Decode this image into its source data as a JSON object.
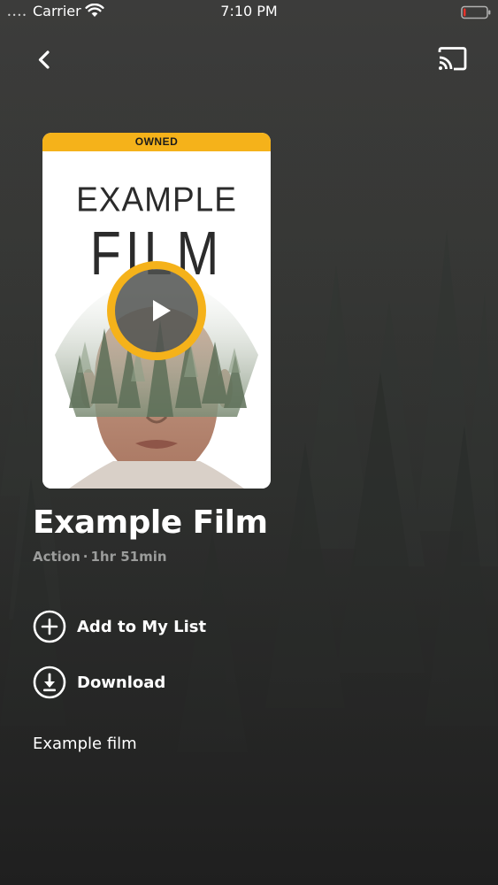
{
  "status_bar": {
    "signal_dots": "••••",
    "carrier": "Carrier",
    "time": "7:10 PM",
    "wifi_icon": "wifi-icon",
    "battery_icon": "battery-low-icon",
    "battery_level": 0.1,
    "battery_color": "#e8332a"
  },
  "nav": {
    "back_icon": "chevron-left-icon",
    "cast_icon": "cast-icon"
  },
  "poster": {
    "badge": "OWNED",
    "badge_color": "#f5b21a",
    "title_line1": "EXAMPLE",
    "title_line2": "FILM",
    "play_icon": "play-icon"
  },
  "film": {
    "title": "Example Film",
    "genre": "Action",
    "separator": "·",
    "duration": "1hr 51min",
    "description": "Example film"
  },
  "actions": {
    "add_to_list": {
      "label": "Add to My List",
      "icon": "plus-circle-icon"
    },
    "download": {
      "label": "Download",
      "icon": "download-circle-icon"
    }
  },
  "colors": {
    "accent": "#f5b21a",
    "meta_text": "#9b9c9b"
  }
}
